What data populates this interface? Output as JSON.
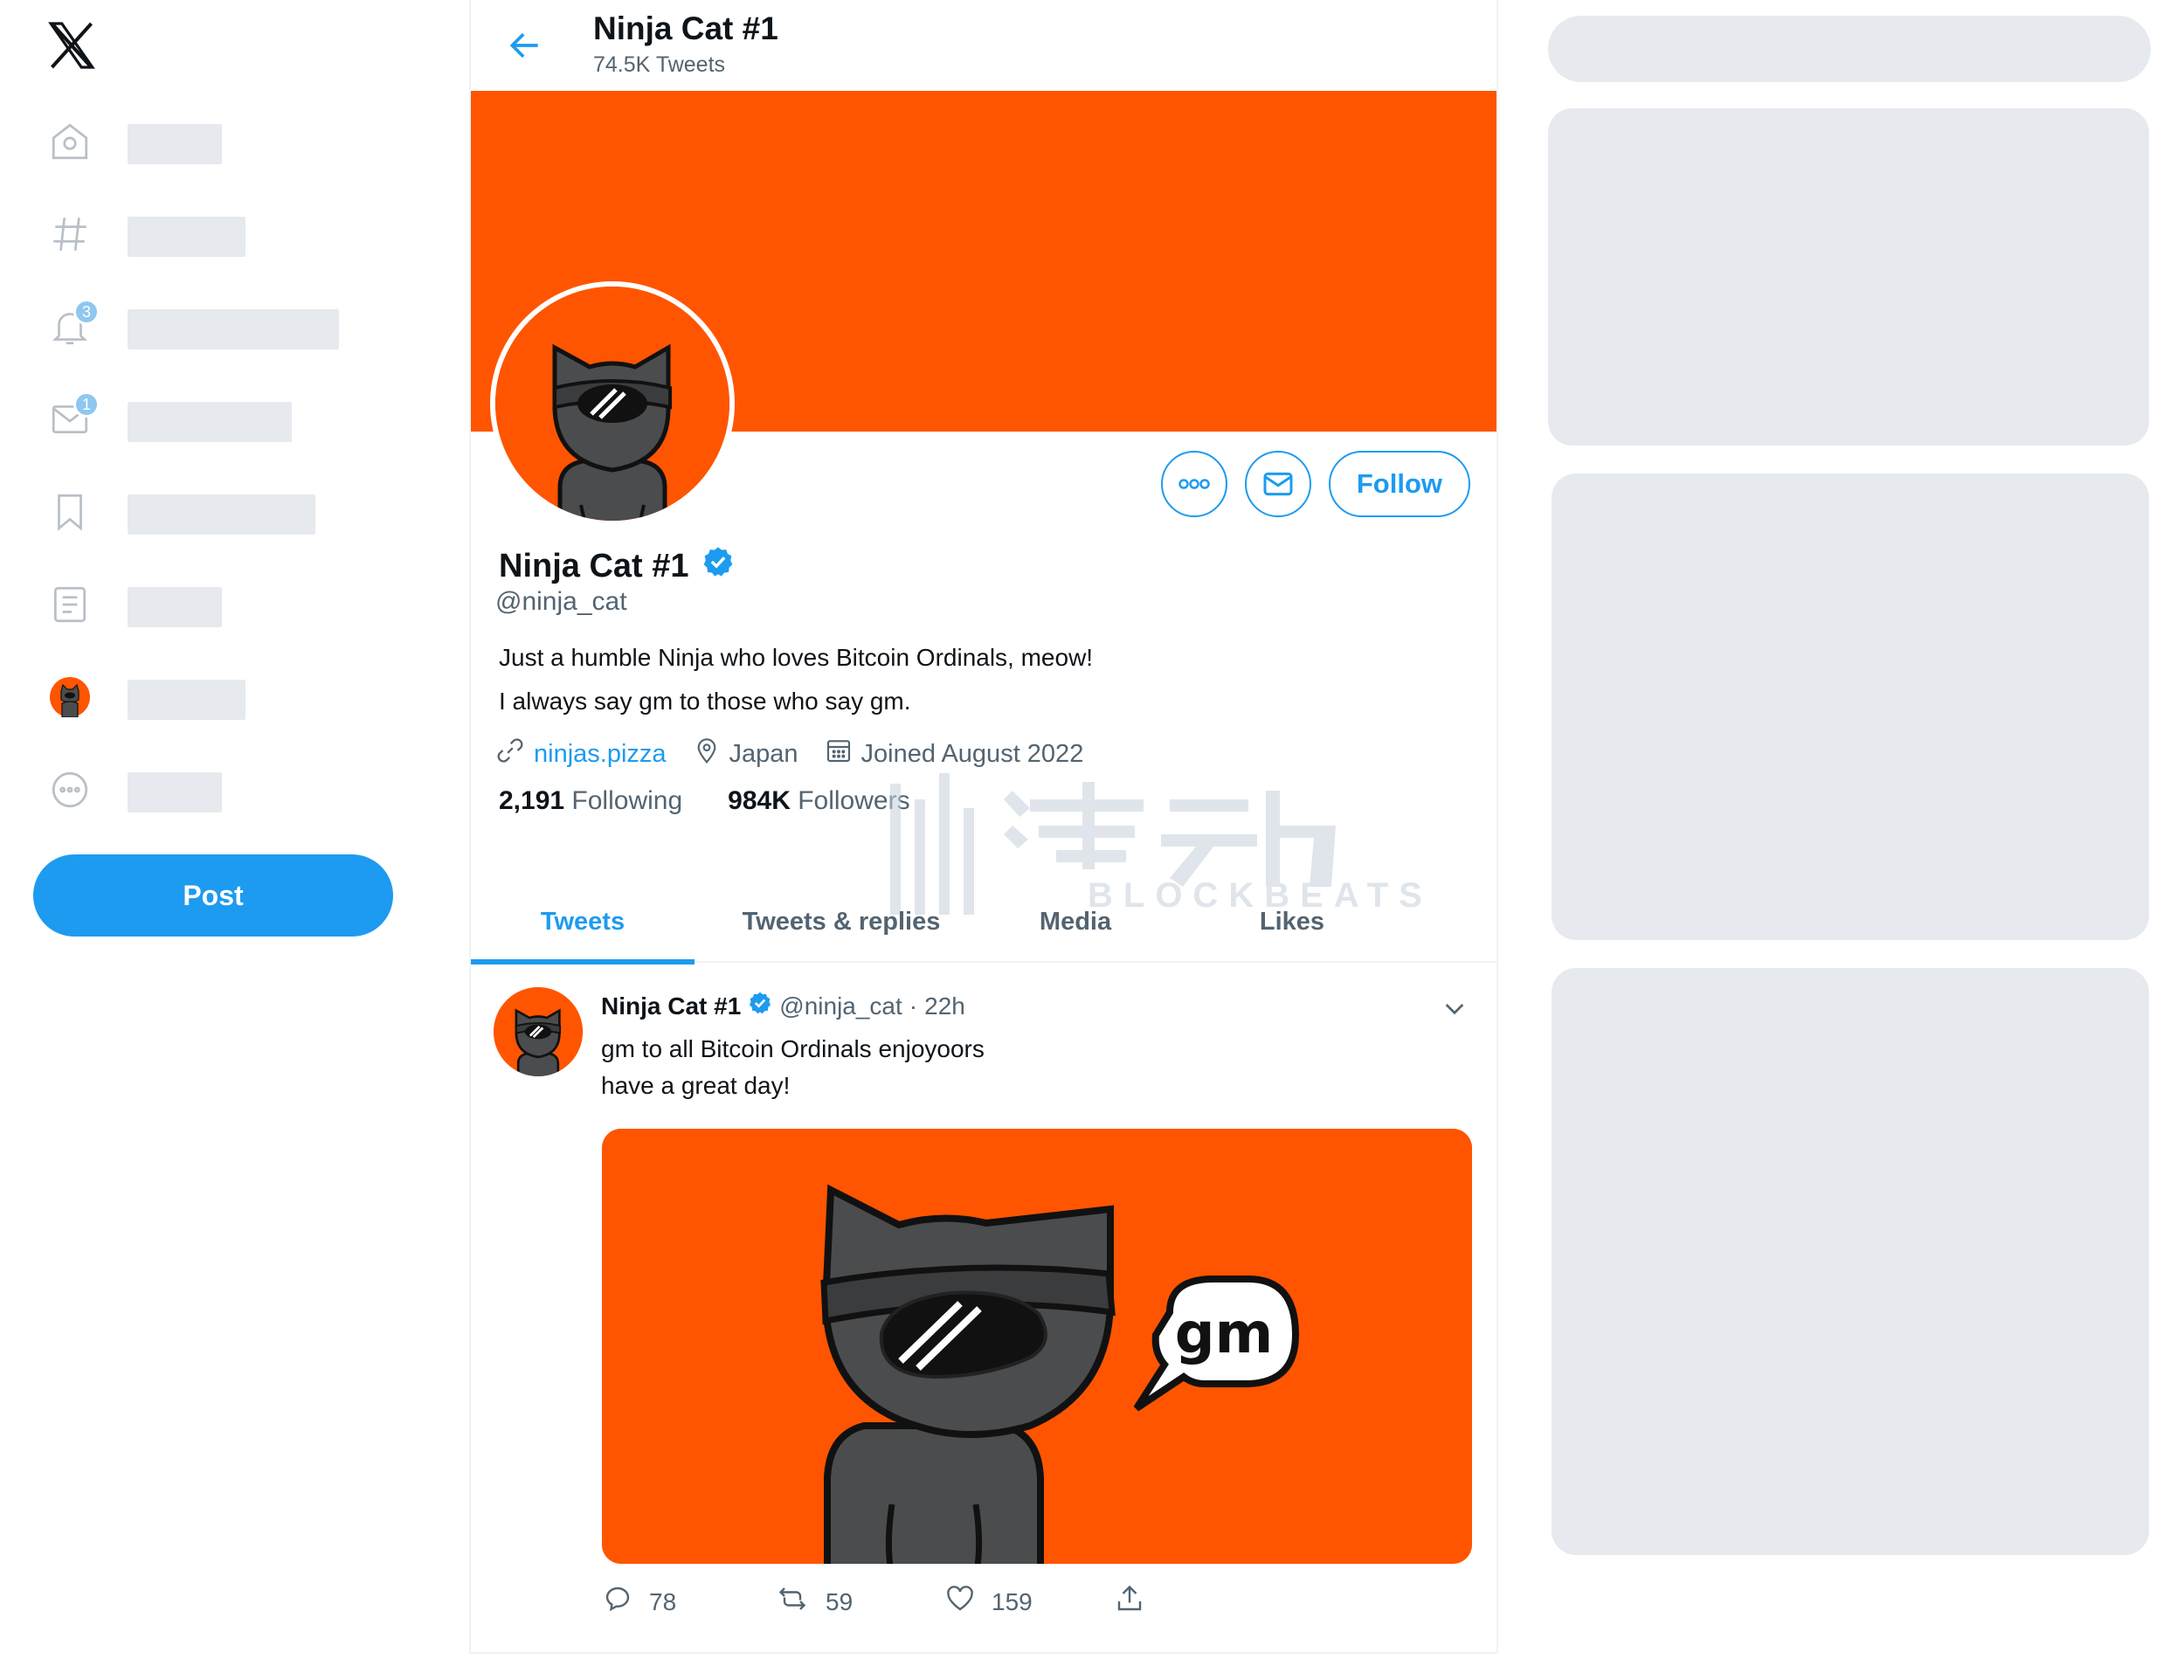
{
  "nav": {
    "badges": {
      "notifications": "3",
      "messages": "1"
    },
    "post_label": "Post"
  },
  "header": {
    "title": "Ninja Cat #1",
    "subtitle": "74.5K Tweets"
  },
  "profile": {
    "name": "Ninja Cat #1",
    "handle": "@ninja_cat",
    "bio_line1": "Just a humble Ninja who loves Bitcoin Ordinals, meow!",
    "bio_line2": "I always say gm to those who say gm.",
    "website": "ninjas.pizza",
    "location": "Japan",
    "joined": "Joined August 2022",
    "following_count": "2,191",
    "following_label": "Following",
    "followers_count": "984K",
    "followers_label": "Followers",
    "follow_label": "Follow"
  },
  "tabs": [
    {
      "label": "Tweets"
    },
    {
      "label": "Tweets & replies"
    },
    {
      "label": "Media"
    },
    {
      "label": "Likes"
    }
  ],
  "watermark": {
    "text": "BLOCKBEATS"
  },
  "tweet": {
    "name": "Ninja Cat #1",
    "handle": "@ninja_cat",
    "dot": "·",
    "time": "22h",
    "line1": "gm to all Bitcoin Ordinals enjoyoors",
    "line2": "have a great day!",
    "speech": "gm",
    "replies": "78",
    "retweets": "59",
    "likes": "159"
  },
  "colors": {
    "accent": "#1d9bf0",
    "banner": "#ff5500",
    "skeleton": "#e6e9ed"
  }
}
